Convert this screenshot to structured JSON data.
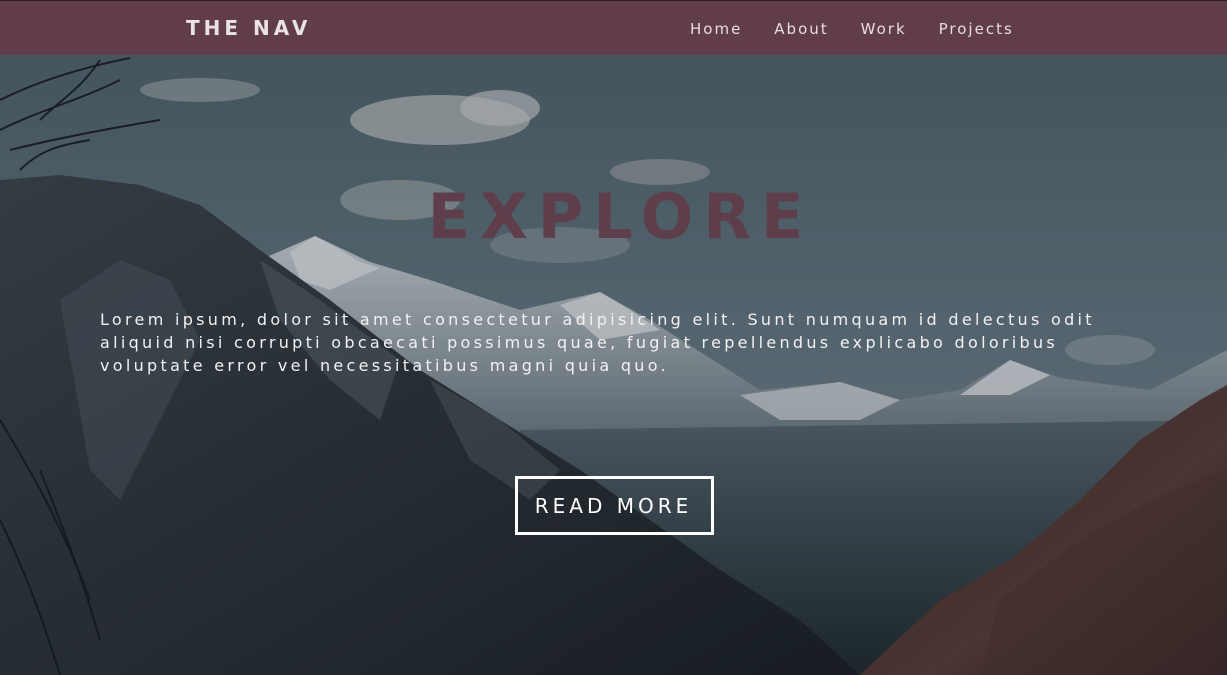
{
  "navbar": {
    "brand": "THE NAV",
    "links": [
      {
        "label": "Home"
      },
      {
        "label": "About"
      },
      {
        "label": "Work"
      },
      {
        "label": "Projects"
      }
    ],
    "background_color": "#613d4b"
  },
  "hero": {
    "title": "EXPLORE",
    "title_color": "#5f3e4b",
    "text": "Lorem ipsum, dolor sit amet consectetur adipisicing elit. Sunt numquam id delectus odit aliquid nisi corrupti obcaecati possimus quae, fugiat repellendus explicabo doloribus voluptate error vel necessitatibus magni quia quo.",
    "button_label": "READ MORE",
    "background_image": "mountain-landscape"
  }
}
